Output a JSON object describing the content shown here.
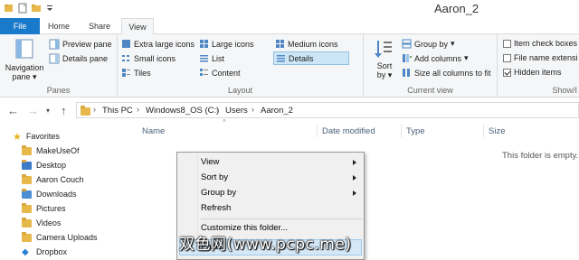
{
  "window": {
    "title": "Aaron_2"
  },
  "tabs": {
    "file": "File",
    "home": "Home",
    "share": "Share",
    "view": "View"
  },
  "ribbon": {
    "panes": {
      "navigation_pane": "Navigation",
      "navigation_pane2": "pane",
      "preview_pane": "Preview pane",
      "details_pane": "Details pane",
      "label": "Panes"
    },
    "layout": {
      "extra_large": "Extra large icons",
      "large": "Large icons",
      "medium": "Medium icons",
      "small": "Small icons",
      "list": "List",
      "details": "Details",
      "tiles": "Tiles",
      "content": "Content",
      "label": "Layout",
      "selected": "Details"
    },
    "current_view": {
      "sort_by": "Sort",
      "sort_by2": "by",
      "group_by": "Group by",
      "add_columns": "Add columns",
      "size_all": "Size all columns to fit",
      "label": "Current view"
    },
    "show_hide": {
      "item_checkboxes": "Item check boxes",
      "file_name_ext": "File name extensi",
      "hidden_items": "Hidden items",
      "hidden_checked": true,
      "label": "Show/I"
    }
  },
  "address": {
    "crumbs": [
      "This PC",
      "Windows8_OS (C:)",
      "Users",
      "Aaron_2"
    ]
  },
  "nav": {
    "favorites": "Favorites",
    "items": [
      "MakeUseOf",
      "Desktop",
      "Aaron Couch",
      "Downloads",
      "Pictures",
      "Videos",
      "Camera Uploads",
      "Dropbox"
    ]
  },
  "columns": {
    "name": "Name",
    "date": "Date modified",
    "type": "Type",
    "size": "Size"
  },
  "empty_text": "This folder is empty.",
  "context_menu": {
    "items": [
      "View",
      "Sort by",
      "Group by",
      "Refresh",
      "Customize this folder...",
      "Paste"
    ],
    "highlighted": "Paste"
  },
  "watermark": "双色网(www.pcpc.me)"
}
